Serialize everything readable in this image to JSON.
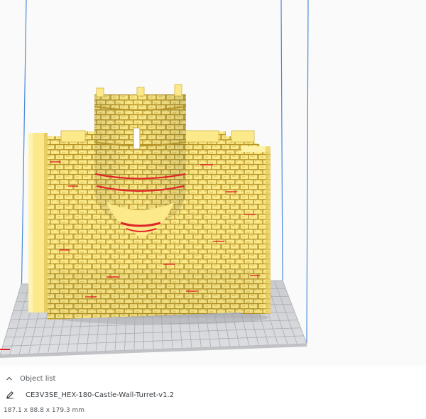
{
  "colors": {
    "model_fill": "#fbe98a",
    "model_mortar": "#b69427",
    "overhang_red": "#e0262a",
    "build_plate": "#d6d8dc",
    "build_volume_edge": "#4a8ad8",
    "viewport_bg": "#fafafa"
  },
  "object_list": {
    "toggle_icon": "chevron-up-icon",
    "label": "Object list"
  },
  "object": {
    "edit_icon": "pencil-icon",
    "name": "CE3V3SE_HEX-180-Castle-Wall-Turret-v1.2",
    "dimensions": "187.1 x 88.8 x 179.3 mm"
  }
}
